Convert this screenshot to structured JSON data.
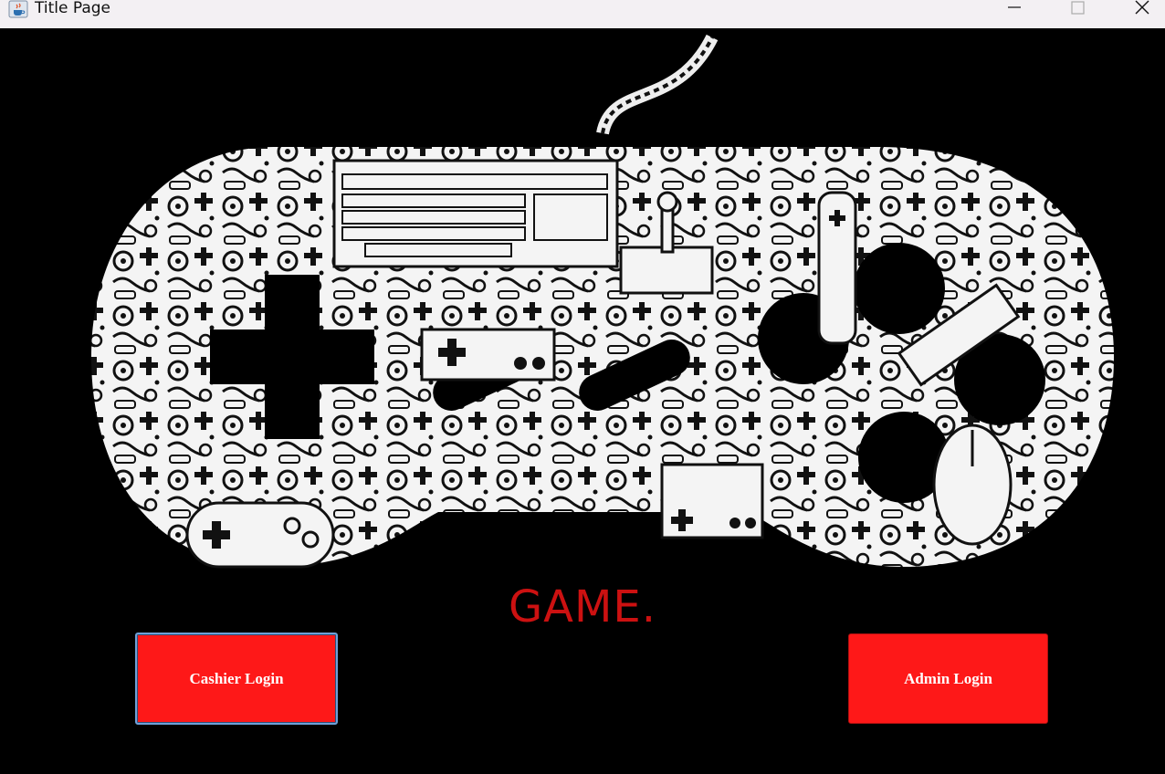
{
  "window": {
    "title": "Title Page",
    "app_icon": "java-coffee-icon",
    "controls": [
      "minimize-icon",
      "maximize-icon",
      "close-icon"
    ]
  },
  "main": {
    "brand_text": "GAME.",
    "brand_color": "#cc1111",
    "background_color": "#000000",
    "artwork": "game-controller-collage-image"
  },
  "buttons": {
    "cashier_label": "Cashier Login",
    "admin_label": "Admin Login",
    "button_color": "#fe1818"
  }
}
